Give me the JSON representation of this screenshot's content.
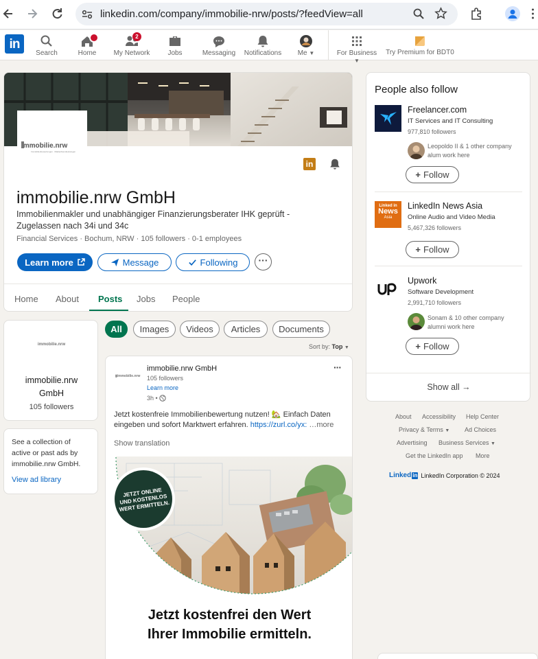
{
  "browser": {
    "url": "linkedin.com/company/immobilie-nrw/posts/?feedView=all"
  },
  "nav": {
    "search": "Search",
    "home": "Home",
    "network": "My Network",
    "network_badge": "2",
    "jobs": "Jobs",
    "messaging": "Messaging",
    "notifications": "Notifications",
    "me": "Me",
    "business": "For Business",
    "premium": "Try Premium for BDT0"
  },
  "company": {
    "logo_text": "immobilie.nrw",
    "logo_sub": "Immobilienbewertungen · Maklerdienstleistungen",
    "name": "immobilie.nrw GmbH",
    "tagline_1": "Immobilienmakler und unabhängiger Finanzierungsberater IHK geprüft -",
    "tagline_2": "Zugelassen nach 34i und 34c",
    "meta": "Financial Services · Bochum, NRW · 105 followers · 0-1 employees",
    "learn_more": "Learn more",
    "message": "Message",
    "following": "Following"
  },
  "tabs": {
    "home": "Home",
    "about": "About",
    "posts": "Posts",
    "jobs": "Jobs",
    "people": "People"
  },
  "sidebar_card": {
    "logo_text": "immobilie.nrw",
    "name_1": "immobilie.nrw",
    "name_2": "GmbH",
    "followers": "105 followers"
  },
  "ads_card": {
    "text_1": "See a collection of",
    "text_2": "active or past ads by",
    "text_3": "immobilie.nrw GmbH.",
    "link": "View ad library"
  },
  "filters": {
    "all": "All",
    "images": "Images",
    "videos": "Videos",
    "articles": "Articles",
    "documents": "Documents",
    "sort_label": "Sort by:",
    "sort_value": "Top"
  },
  "post": {
    "author": "immobilie.nrw GmbH",
    "followers": "105 followers",
    "learn_more": "Learn more",
    "time": "3h •",
    "text_1": "Jetzt kostenfreie Immobilienbewertung nutzen! 🏡 Einfach Daten",
    "text_2": "eingeben und sofort Marktwert erfahren.",
    "link": "https://zurl.co/yx:",
    "more": "…more",
    "show_translation": "Show translation",
    "badge_1": "JETZT ONLINE",
    "badge_2": "UND KOSTENLOS",
    "badge_3": "WERT ERMITTELN.",
    "headline_1": "Jetzt kostenfrei den Wert",
    "headline_2": "Ihrer Immobilie ermitteln."
  },
  "people_also_follow": {
    "title": "People also follow",
    "items": [
      {
        "name": "Freelancer.com",
        "industry": "IT Services and IT Consulting",
        "followers": "977,810 followers",
        "connection_1": "Leopoldo II & 1 other company",
        "connection_2": "alum work here",
        "follow": "Follow"
      },
      {
        "name": "LinkedIn News Asia",
        "industry": "Online Audio and Video Media",
        "followers": "5,467,326 followers",
        "follow": "Follow",
        "logo_1": "Linked in",
        "logo_2": "News",
        "logo_3": "Asia"
      },
      {
        "name": "Upwork",
        "industry": "Software Development",
        "followers": "2,991,710 followers",
        "connection_1": "Sonam & 10 other company",
        "connection_2": "alumni work here",
        "follow": "Follow"
      }
    ],
    "show_all": "Show all"
  },
  "footer": {
    "about": "About",
    "accessibility": "Accessibility",
    "help": "Help Center",
    "privacy": "Privacy & Terms",
    "ad_choices": "Ad Choices",
    "advertising": "Advertising",
    "business_services": "Business Services",
    "get_app": "Get the LinkedIn app",
    "more": "More",
    "brand": "Linked",
    "copyright": "LinkedIn Corporation © 2024"
  },
  "colors": {
    "linkedin_blue": "#0a66c2",
    "green_active": "#01754f",
    "notification_red": "#cb112d"
  }
}
